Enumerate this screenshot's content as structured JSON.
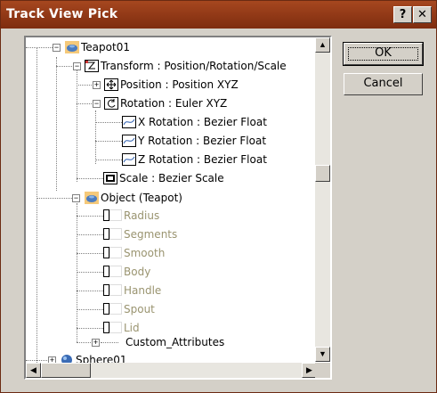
{
  "window": {
    "title": "Track View Pick",
    "help_label": "?",
    "close_label": "✕"
  },
  "buttons": {
    "ok": "OK",
    "cancel": "Cancel"
  },
  "tree": {
    "items": [
      {
        "label": "Teapot01",
        "icon": "teapot-icon",
        "expander": "−"
      },
      {
        "label": "Transform : Position/Rotation/Scale",
        "icon": "transform-icon",
        "expander": "−"
      },
      {
        "label": "Position : Position XYZ",
        "icon": "position-icon",
        "expander": "+"
      },
      {
        "label": "Rotation : Euler XYZ",
        "icon": "rotation-icon",
        "expander": "−"
      },
      {
        "label": "X Rotation : Bezier Float",
        "icon": "curve-icon",
        "expander": ""
      },
      {
        "label": "Y Rotation : Bezier Float",
        "icon": "curve-icon",
        "expander": ""
      },
      {
        "label": "Z Rotation : Bezier Float",
        "icon": "curve-icon",
        "expander": ""
      },
      {
        "label": "Scale : Bezier Scale",
        "icon": "scale-icon",
        "expander": ""
      },
      {
        "label": "Object (Teapot)",
        "icon": "teapot-icon",
        "expander": "−"
      },
      {
        "label": "Radius",
        "icon": "param-icon",
        "expander": ""
      },
      {
        "label": "Segments",
        "icon": "param-icon",
        "expander": ""
      },
      {
        "label": "Smooth",
        "icon": "param-icon",
        "expander": ""
      },
      {
        "label": "Body",
        "icon": "param-icon",
        "expander": ""
      },
      {
        "label": "Handle",
        "icon": "param-icon",
        "expander": ""
      },
      {
        "label": "Spout",
        "icon": "param-icon",
        "expander": ""
      },
      {
        "label": "Lid",
        "icon": "param-icon",
        "expander": ""
      },
      {
        "label": "Custom_Attributes",
        "icon": "",
        "expander": "+"
      },
      {
        "label": "Sphere01",
        "icon": "sphere-icon",
        "expander": "+"
      }
    ]
  },
  "scrollbars": {
    "up_arrow": "▲",
    "down_arrow": "▼",
    "left_arrow": "◀",
    "right_arrow": "▶"
  }
}
